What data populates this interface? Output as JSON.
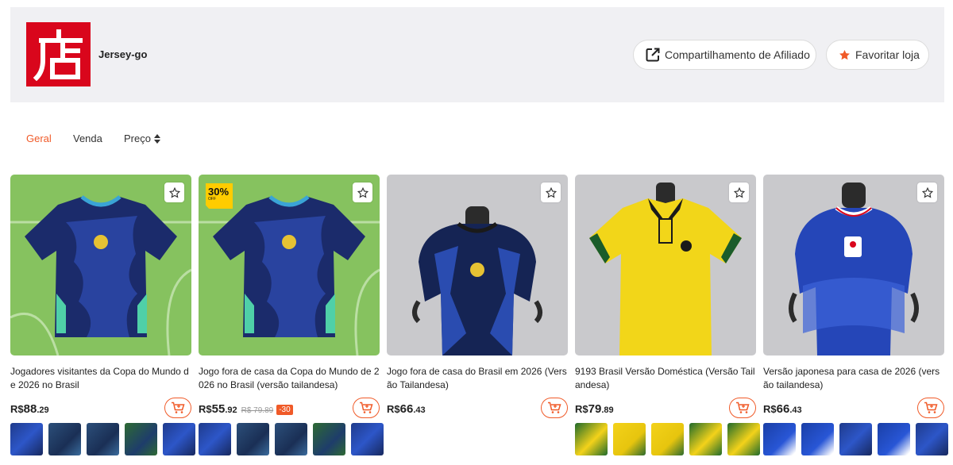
{
  "store": {
    "name": "Jersey-go",
    "logo_char": "店",
    "share_label": "Compartilhamento de Afiliado",
    "favorite_label": "Favoritar loja",
    "brand_color": "#d9061c",
    "accent_color": "#f05a28"
  },
  "tabs": {
    "geral": "Geral",
    "venda": "Venda",
    "preco": "Preço"
  },
  "products": [
    {
      "title": "Jogadores visitantes da Copa do Mundo de 2026 no Brasil",
      "currency": "R$",
      "price_int": "88",
      "price_dec": ".29",
      "thumb_icons": [
        "thumbnail-image",
        "thumbnail-image",
        "thumbnail-image",
        "thumbnail-image",
        "thumbnail-image"
      ]
    },
    {
      "title": "Jogo fora de casa da Copa do Mundo de 2026 no Brasil (versão tailandesa)",
      "currency": "R$",
      "price_int": "55",
      "price_dec": ".92",
      "old_price": "R$ 79.89",
      "discount_badge": "-30",
      "discount_tag": "30%",
      "discount_tag_sub": "OFF"
    },
    {
      "title": "Jogo fora de casa do Brasil em 2026 (Versão Tailandesa)",
      "currency": "R$",
      "price_int": "66",
      "price_dec": ".43"
    },
    {
      "title": "9193 Brasil Versão Doméstica (Versão Tailandesa)",
      "currency": "R$",
      "price_int": "79",
      "price_dec": ".89"
    },
    {
      "title": "Versão japonesa para casa de 2026 (versão tailandesa)",
      "currency": "R$",
      "price_int": "66",
      "price_dec": ".43"
    }
  ]
}
